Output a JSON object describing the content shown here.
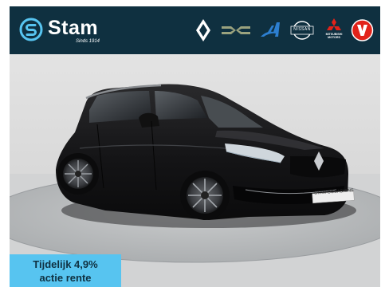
{
  "header": {
    "brand_name": "Stam",
    "brand_since": "Sinds 1914",
    "partner_logos": [
      {
        "icon": "renault-icon"
      },
      {
        "icon": "dacia-icon"
      },
      {
        "icon": "alpine-icon"
      },
      {
        "icon": "nissan-icon",
        "text": "NISSAN"
      },
      {
        "icon": "mitsubishi-icon",
        "text": "MITSUBISHI MOTORS"
      },
      {
        "icon": "v-icon"
      }
    ]
  },
  "listing": {
    "plate_text": "STAM OCCASIONS",
    "promo_line1": "Tijdelijk 4,9%",
    "promo_line2": "actie rente"
  },
  "colors": {
    "header_bg": "#0f3040",
    "promo_bg": "#57c4f0",
    "promo_text": "#0f3040",
    "brand_accent": "#57c4f0",
    "v_logo": "#e2231a"
  }
}
